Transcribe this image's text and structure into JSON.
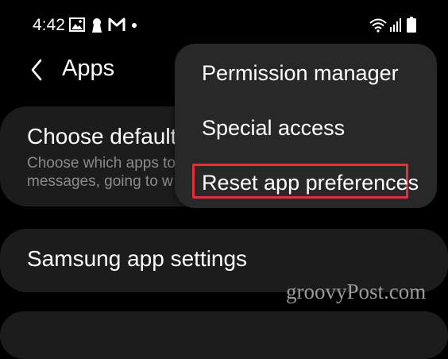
{
  "status_bar": {
    "time": "4:42",
    "left_icons": [
      "image-icon",
      "keyhole-icon",
      "gmail-icon",
      "notification-dot-icon"
    ],
    "right_icons": [
      "wifi-icon",
      "signal-icon",
      "battery-icon"
    ]
  },
  "header": {
    "title": "Apps"
  },
  "cards": {
    "default_apps": {
      "title": "Choose default",
      "description": "Choose which apps to\nmessages, going to w"
    },
    "samsung": {
      "title": "Samsung app settings"
    }
  },
  "menu": {
    "items": [
      {
        "label": "Permission manager"
      },
      {
        "label": "Special access"
      },
      {
        "label": "Reset app preferences",
        "highlighted": true
      }
    ],
    "highlight_color": "#e03137"
  },
  "watermark": "groovyPost.com"
}
